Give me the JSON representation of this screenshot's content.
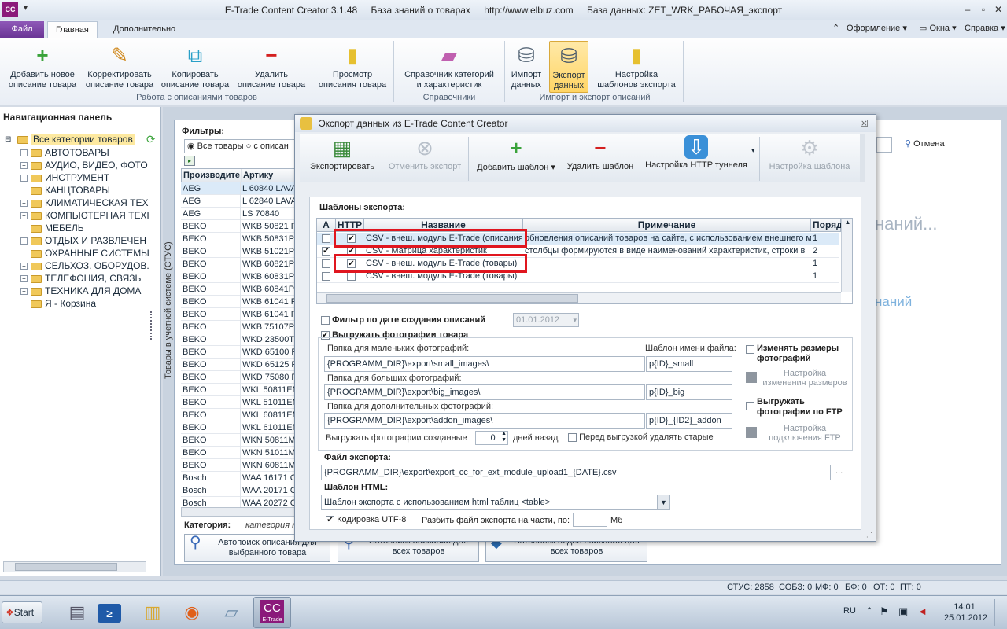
{
  "app": {
    "icon_text": "CC",
    "title_parts": [
      "E-Trade Content Creator 3.1.48",
      "База знаний о товарах",
      "http://www.elbuz.com",
      "База данных: ZET_WRK_РАБОЧАЯ_экспорт"
    ]
  },
  "tabs": {
    "file": "Файл",
    "main": "Главная",
    "extra": "Дополнительно"
  },
  "right_menu": {
    "design": "Оформление",
    "window": "Окна",
    "help": "Справка"
  },
  "ribbon": {
    "add": [
      "Добавить новое",
      "описание товара"
    ],
    "edit": [
      "Корректировать",
      "описание товара"
    ],
    "copy": [
      "Копировать",
      "описание товара"
    ],
    "delete": [
      "Удалить",
      "описание товара"
    ],
    "view": [
      "Просмотр",
      "описания товара"
    ],
    "catalog": [
      "Справочник категорий",
      "и характеристик"
    ],
    "import": [
      "Импорт",
      "данных"
    ],
    "export": [
      "Экспорт",
      "данных"
    ],
    "templates": [
      "Настройка",
      "шаблонов экспорта"
    ],
    "groups": {
      "work": "Работа с описаниями товаров",
      "refs": "Справочники",
      "io": "Импорт и экспорт описаний"
    }
  },
  "nav": {
    "title": "Навигационная панель",
    "root": "Все категории товаров",
    "items": [
      {
        "label": "АВТОТОВАРЫ",
        "expandable": true
      },
      {
        "label": "АУДИО, ВИДЕО, ФОТО",
        "expandable": true
      },
      {
        "label": "ИНСТРУМЕНТ",
        "expandable": true
      },
      {
        "label": "КАНЦТОВАРЫ",
        "expandable": false
      },
      {
        "label": "КЛИМАТИЧЕСКАЯ ТЕХ",
        "expandable": true
      },
      {
        "label": "КОМПЬЮТЕРНАЯ ТЕХН",
        "expandable": true
      },
      {
        "label": "МЕБЕЛЬ",
        "expandable": false
      },
      {
        "label": "ОТДЫХ И РАЗВЛЕЧЕН",
        "expandable": true
      },
      {
        "label": "ОХРАННЫЕ СИСТЕМЫ",
        "expandable": false
      },
      {
        "label": "СЕЛЬХОЗ. ОБОРУДОВ.",
        "expandable": true
      },
      {
        "label": "ТЕЛЕФОНИЯ, СВЯЗЬ",
        "expandable": true
      },
      {
        "label": "ТЕХНИКА ДЛЯ ДОМА",
        "expandable": true
      },
      {
        "label": "Я - Корзина",
        "expandable": false
      }
    ]
  },
  "main": {
    "vertical_label": "Товары в учетной системе (СТУС)",
    "filters_label": "Фильтры:",
    "filter_all": "Все товары",
    "filter_with": "с описан",
    "col_maker": "Производите",
    "col_sku": "Артику",
    "rows": [
      [
        "AEG",
        "L 60840 LAVA"
      ],
      [
        "AEG",
        "L 62840 LAVA"
      ],
      [
        "AEG",
        "LS 70840"
      ],
      [
        "BEKO",
        "WKB 50821 P"
      ],
      [
        "BEKO",
        "WKB 50831PT"
      ],
      [
        "BEKO",
        "WKB 51021PT"
      ],
      [
        "BEKO",
        "WKB 60821P"
      ],
      [
        "BEKO",
        "WKB 60831PT"
      ],
      [
        "BEKO",
        "WKB 60841PT"
      ],
      [
        "BEKO",
        "WKB 61041 P"
      ],
      [
        "BEKO",
        "WKB 61041 P"
      ],
      [
        "BEKO",
        "WKB 75107PT"
      ],
      [
        "BEKO",
        "WKD 23500T"
      ],
      [
        "BEKO",
        "WKD 65100 R"
      ],
      [
        "BEKO",
        "WKD 65125 R"
      ],
      [
        "BEKO",
        "WKD 75080 R"
      ],
      [
        "BEKO",
        "WKL 50811EM"
      ],
      [
        "BEKO",
        "WKL 51011EM"
      ],
      [
        "BEKO",
        "WKL 60811EM"
      ],
      [
        "BEKO",
        "WKL 61011EM"
      ],
      [
        "BEKO",
        "WKN 50811M"
      ],
      [
        "BEKO",
        "WKN 51011M"
      ],
      [
        "BEKO",
        "WKN 60811M"
      ],
      [
        "Bosch",
        "WAA 16171 C"
      ],
      [
        "Bosch",
        "WAA 20171 C"
      ],
      [
        "Bosch",
        "WAA 20272 C"
      ]
    ],
    "category_label": "Категория:",
    "category_value": "категория н",
    "cancel": "Отмена",
    "ghost1": "наний...",
    "ghost2": "наний",
    "auto1": [
      "Автопоиск описания для",
      "выбранного товара"
    ],
    "auto2": [
      "Автопоиск описаний для",
      "всех товаров"
    ],
    "auto3": [
      "Автопоиск видео описаний для",
      "всех товаров"
    ]
  },
  "dialog": {
    "title": "Экспорт данных из E-Trade Content Creator",
    "toolbar": {
      "export": "Экспортировать",
      "cancel_export": "Отменить экспорт",
      "add_template": "Добавить шаблон",
      "delete_template": "Удалить шаблон",
      "http_tunnel": "Настройка HTTP туннеля",
      "template_settings": "Настройка шаблона"
    },
    "templates_label": "Шаблоны экспорта:",
    "columns": {
      "a": "A",
      "http": "HTTP",
      "name": "Название",
      "note": "Примечание",
      "order": "Поряд"
    },
    "rows": [
      {
        "a": false,
        "http": true,
        "name": "CSV - внеш. модуль E-Trade (описания)",
        "note": "обновления описаний товаров на сайте, с использованием внешнего м",
        "order": "1"
      },
      {
        "a": true,
        "http": true,
        "name": "CSV - Матрица характеристик",
        "note": "столбцы формируются в виде наименований характеристик, строки в",
        "order": "2"
      },
      {
        "a": false,
        "http": true,
        "name": "CSV - внеш. модуль E-Trade (товары)",
        "note": "",
        "order": "1"
      },
      {
        "a": false,
        "http": false,
        "name": "CSV - внеш. модуль E-Trade (товары)",
        "note": "",
        "order": "1"
      }
    ],
    "date_filter_label": "Фильтр по дате создания описаний",
    "date_value": "01.01.2012",
    "photos_label": "Выгружать фотографии товара",
    "small_folder_label": "Папка для маленьких фотографий:",
    "small_folder": "{PROGRAMM_DIR}\\export\\small_images\\",
    "filename_tpl_label": "Шаблон имени файла:",
    "small_tpl": "p{ID}_small",
    "big_folder_label": "Папка для больших фотографий:",
    "big_folder": "{PROGRAMM_DIR}\\export\\big_images\\",
    "big_tpl": "p{ID}_big",
    "addon_folder_label": "Папка для дополнительных фотографий:",
    "addon_folder": "{PROGRAMM_DIR}\\export\\addon_images\\",
    "addon_tpl": "p{ID}_{ID2}_addon",
    "days_label_pre": "Выгружать фотографии созданные",
    "days_value": "0",
    "days_label_post": "дней назад",
    "delete_old_label": "Перед выгрузкой удалять старые",
    "resize_label": [
      "Изменять размеры",
      "фотографий"
    ],
    "resize_settings": [
      "Настройка",
      "изменения размеров"
    ],
    "ftp_label": [
      "Выгружать",
      "фотографии по FTP"
    ],
    "ftp_settings": [
      "Настройка",
      "подключения FTP"
    ],
    "export_file_label": "Файл экспорта:",
    "export_file": "{PROGRAMM_DIR}\\export\\export_cc_for_ext_module_upload1_{DATE}.csv",
    "browse": "...",
    "html_tpl_label": "Шаблон HTML:",
    "html_tpl": "Шаблон экспорта с использованием html таблиц <table>",
    "utf8_label": "Кодировка UTF-8",
    "split_label": "Разбить файл экспорта на части, по:",
    "split_unit": "Мб"
  },
  "status": {
    "stus": "СТУС: 2858",
    "sobz": "СОБЗ: 0",
    "mf": "МФ: 0",
    "bf": "БФ: 0",
    "ot": "ОТ: 0",
    "pt": "ПТ: 0"
  },
  "taskbar": {
    "start": "Start",
    "lang": "RU",
    "time": "14:01",
    "date": "25.01.2012",
    "cc_label": "E-Trade",
    "cc_text": "CC"
  },
  "colors": {
    "accent": "#7b3fa8",
    "highlight": "#e0161f",
    "selected": "#ffd565"
  }
}
